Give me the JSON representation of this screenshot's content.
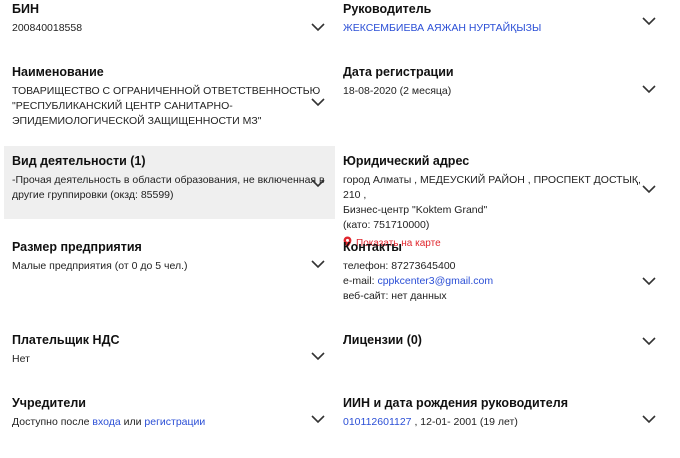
{
  "left": [
    {
      "label": "БИН",
      "value": "200840018558"
    },
    {
      "label": "Наименование",
      "lines": [
        "ТОВАРИЩЕСТВО С ОГРАНИЧЕННОЙ ОТВЕТСТВЕННОСТЬЮ",
        "\"РЕСПУБЛИКАНСКИЙ ЦЕНТР САНИТАРНО-",
        "ЭПИДЕМИОЛОГИЧЕСКОЙ ЗАЩИЩЕННОСТИ МЗ\""
      ]
    },
    {
      "label": "Вид деятельности (1)",
      "lines": [
        "-Прочая деятельность в области образования, не включенная в",
        "другие группировки (окзд: 85599)"
      ]
    },
    {
      "label": "Размер предприятия",
      "value": "Малые предприятия (от 0 до 5 чел.)"
    },
    {
      "label": "Плательщик НДС",
      "value": "Нет"
    },
    {
      "label": "Учредители",
      "prefix": "Доступно после ",
      "login": "входа",
      "or": " или ",
      "register": "регистрации"
    }
  ],
  "right": [
    {
      "label": "Руководитель",
      "value": "ЖЕКСЕМБИЕВА АЯЖАН НУРТАЙҚЫЗЫ"
    },
    {
      "label": "Дата регистрации",
      "value": "18-08-2020 (2 месяца)"
    },
    {
      "label": "Юридический адрес",
      "lines": [
        "город Алматы , МЕДЕУСКИЙ РАЙОН , ПРОСПЕКТ ДОСТЫҚ, 210 ,",
        "Бизнес-центр \"Koktem Grand\"",
        "(като: 751710000)"
      ],
      "map_link": "Показать на карте"
    },
    {
      "label": "Контакты",
      "phone": "телефон: 87273645400",
      "email_label": "e-mail: ",
      "email": "cppkcenter3@gmail.com",
      "site": "веб-сайт: нет данных"
    },
    {
      "label": "Лицензии (0)"
    },
    {
      "label": "ИИН и дата рождения руководителя",
      "iin": "010112601127",
      "dob": " , 12-01- 2001 (19 лет)"
    }
  ],
  "colors": {
    "link": "#2b4fd6",
    "map_pin": "#e0262d",
    "highlight": "#efefef"
  },
  "icons": [
    "chevron-down-icon",
    "map-pin-icon"
  ]
}
